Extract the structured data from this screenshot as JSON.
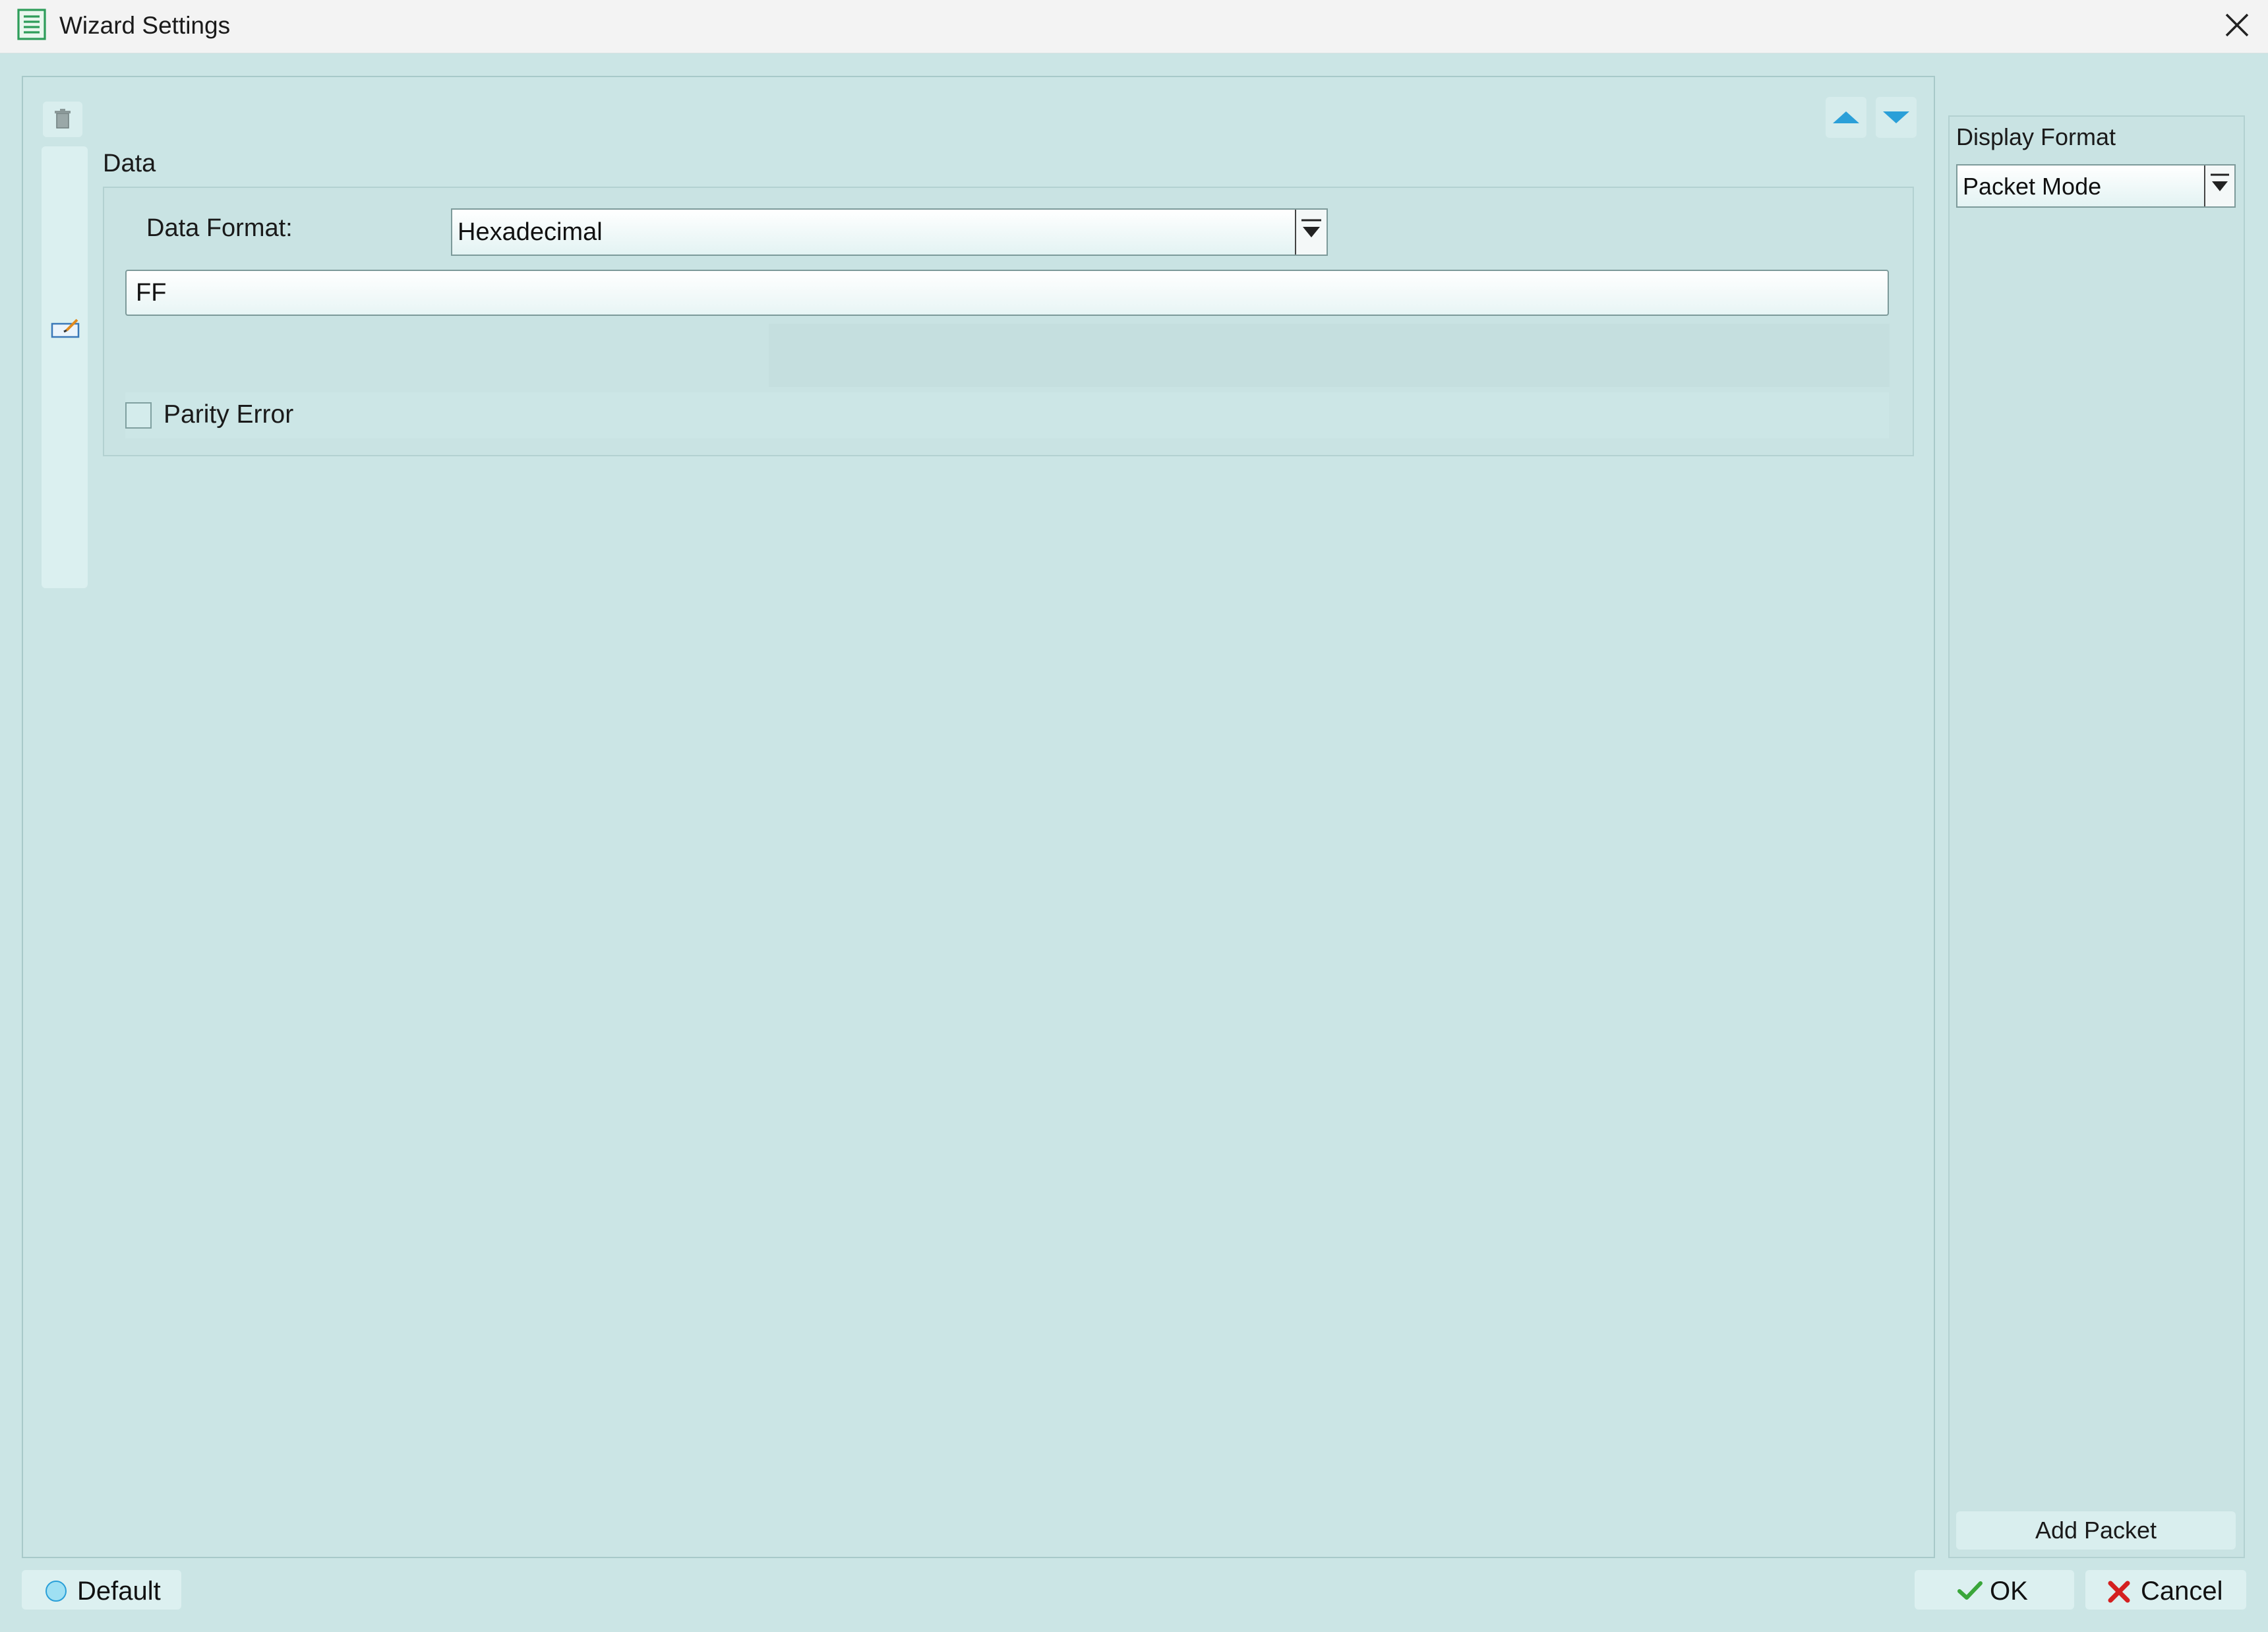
{
  "window": {
    "title": "Wizard Settings"
  },
  "main": {
    "group_label": "Data",
    "data_format_label": "Data Format:",
    "data_format_value": "Hexadecimal",
    "data_value": "FF",
    "parity_label": "Parity Error",
    "parity_checked": false
  },
  "sidebar": {
    "display_format_label": "Display Format",
    "display_format_value": "Packet Mode",
    "add_packet_label": "Add Packet"
  },
  "footer": {
    "default_label": "Default",
    "ok_label": "OK",
    "cancel_label": "Cancel"
  },
  "colors": {
    "background": "#cbe5e5",
    "accent_arrow": "#2a9fd8",
    "ok_check": "#3aa63a",
    "cancel_x": "#d42020"
  },
  "icons": [
    "document-icon",
    "close-icon",
    "trash-icon",
    "arrow-up-icon",
    "arrow-down-icon",
    "edit-icon",
    "dropdown-arrow-icon",
    "radio-circle-icon",
    "check-icon",
    "x-icon"
  ]
}
